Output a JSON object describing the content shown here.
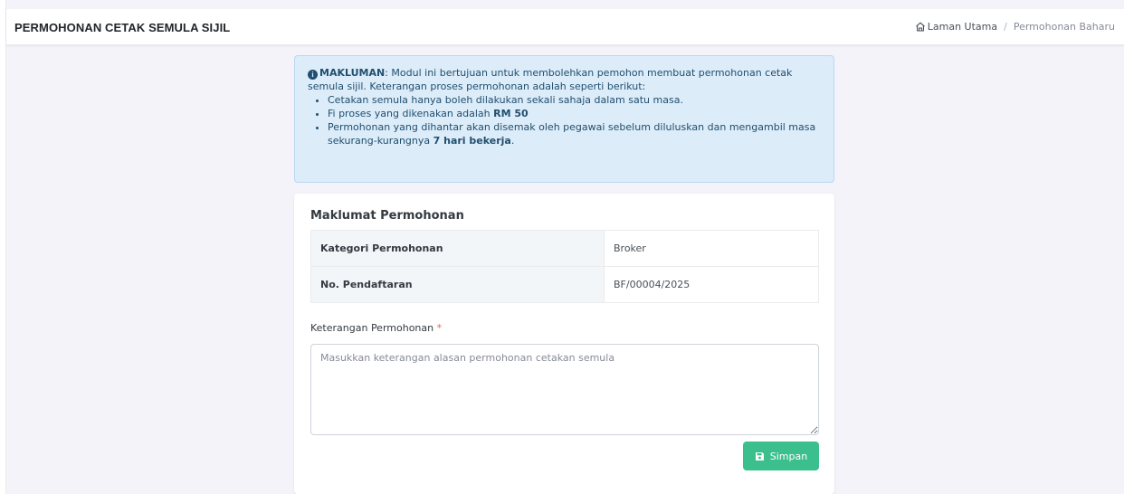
{
  "header": {
    "title": "PERMOHONAN CETAK SEMULA SIJIL",
    "breadcrumb": {
      "home": "Laman Utama",
      "separator": "/",
      "current": "Permohonan Baharu"
    }
  },
  "notice": {
    "label": "MAKLUMAN",
    "intro": ": Modul ini bertujuan untuk membolehkan pemohon membuat permohonan cetak semula sijil. Keterangan proses permohonan adalah seperti berikut:",
    "item1": "Cetakan semula hanya boleh dilakukan sekali sahaja dalam satu masa.",
    "item2_prefix": "Fi proses yang dikenakan adalah ",
    "item2_bold": "RM 50",
    "item3_prefix": "Permohonan yang dihantar akan disemak oleh pegawai sebelum diluluskan dan mengambil masa sekurang-kurangnya ",
    "item3_bold": "7 hari bekerja",
    "item3_suffix": "."
  },
  "form": {
    "section_title": "Maklumat Permohonan",
    "rows": [
      {
        "label": "Kategori Permohonan",
        "value": "Broker"
      },
      {
        "label": "No. Pendaftaran",
        "value": "BF/00004/2025"
      }
    ],
    "reason_label": "Keterangan Permohonan",
    "required_mark": "*",
    "reason_placeholder": "Masukkan keterangan alasan permohonan cetakan semula",
    "reason_value": "",
    "save_label": "Simpan"
  },
  "colors": {
    "alert_bg": "#dcecf9",
    "alert_text": "#214f6f",
    "save_button": "#3bbf8d",
    "required": "#f06548"
  },
  "icons": {
    "home": "home-icon",
    "info": "info-circle-icon",
    "save": "floppy-disk-icon"
  }
}
